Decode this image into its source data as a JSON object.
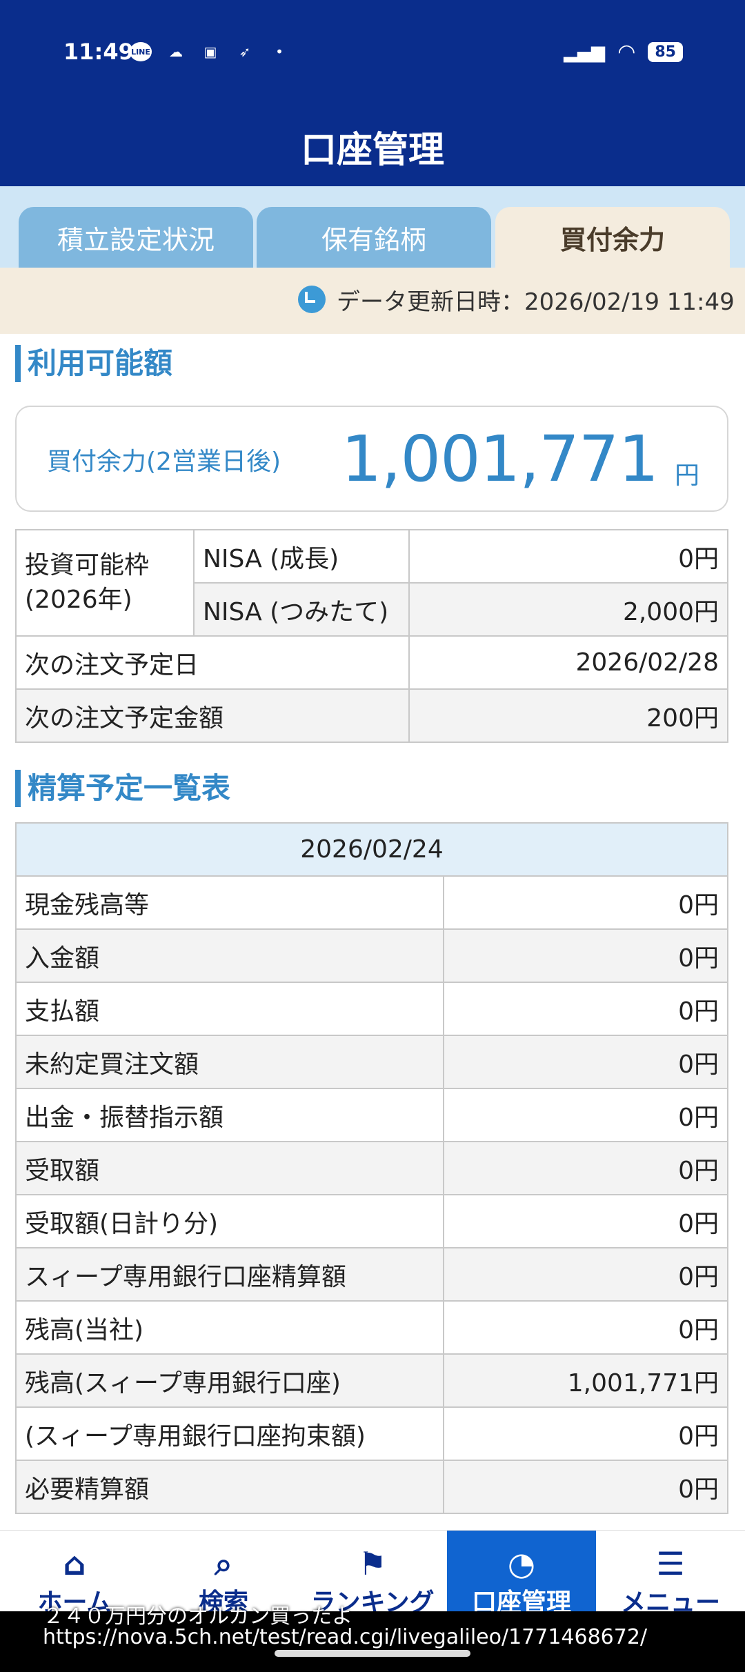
{
  "status_bar": {
    "time": "11:49",
    "battery": "85"
  },
  "header": {
    "title": "口座管理"
  },
  "tabs": [
    {
      "label": "積立設定状況"
    },
    {
      "label": "保有銘柄"
    },
    {
      "label": "買付余力"
    }
  ],
  "update": {
    "text": "データ更新日時：2026/02/19 11:49"
  },
  "section1": {
    "title": "利用可能額",
    "amount_label": "買付余力(2営業日後)",
    "amount_value": "1,001,771",
    "amount_unit": "円",
    "invest_label": "投資可能枠",
    "invest_year": "(2026年)",
    "nisa_growth_label": "NISA (成長)",
    "nisa_growth_value": "0円",
    "nisa_tsumitate_label": "NISA (つみたて)",
    "nisa_tsumitate_value": "2,000円",
    "next_date_label": "次の注文予定日",
    "next_date_value": "2026/02/28",
    "next_amount_label": "次の注文予定金額",
    "next_amount_value": "200円"
  },
  "section2": {
    "title": "精算予定一覧表",
    "date": "2026/02/24",
    "rows": [
      {
        "label": "現金残高等",
        "value": "0円"
      },
      {
        "label": "入金額",
        "value": "0円"
      },
      {
        "label": "支払額",
        "value": "0円"
      },
      {
        "label": "未約定買注文額",
        "value": "0円"
      },
      {
        "label": "出金・振替指示額",
        "value": "0円"
      },
      {
        "label": "受取額",
        "value": "0円"
      },
      {
        "label": "受取額(日計り分)",
        "value": "0円"
      },
      {
        "label": "スィープ専用銀行口座精算額",
        "value": "0円"
      },
      {
        "label": "残高(当社)",
        "value": "0円"
      },
      {
        "label": "残高(スィープ専用銀行口座)",
        "value": "1,001,771円"
      },
      {
        "label": "(スィープ専用銀行口座拘束額)",
        "value": "0円"
      },
      {
        "label": "必要精算額",
        "value": "0円"
      }
    ]
  },
  "bottom_nav": [
    {
      "label": "ホーム",
      "icon": "home-icon"
    },
    {
      "label": "検索",
      "icon": "search-icon"
    },
    {
      "label": "ランキング",
      "icon": "ranking-icon"
    },
    {
      "label": "口座管理",
      "icon": "piggy-bank-icon"
    },
    {
      "label": "メニュー",
      "icon": "menu-icon"
    }
  ],
  "captions": {
    "line1": "２４０万円分のオルカン買ったよ",
    "line2": "https://nova.5ch.net/test/read.cgi/livegalileo/1771468672/"
  }
}
